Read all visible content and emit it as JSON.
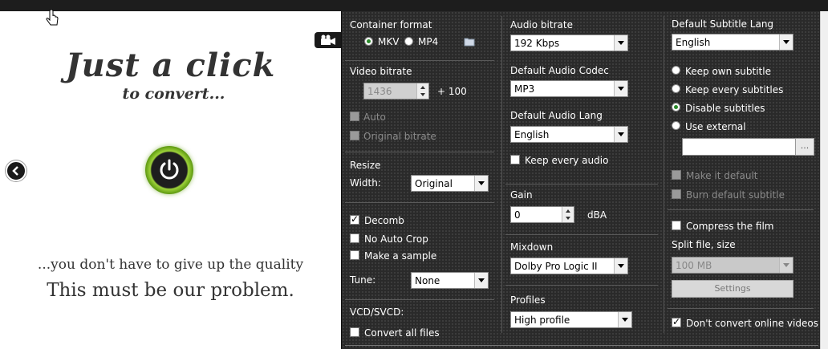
{
  "promo": {
    "headline": "Just a click",
    "subheadline": "to convert...",
    "tagline_1": "...you don't have to give up the quality",
    "tagline_2": "This must be our problem."
  },
  "col1": {
    "container_format_label": "Container format",
    "format_options": [
      "MKV",
      "MP4"
    ],
    "format_selected": "MKV",
    "video_bitrate_label": "Video bitrate",
    "video_bitrate_value": "1436",
    "video_bitrate_extra": "+ 100",
    "auto_label": "Auto",
    "original_bitrate_label": "Original bitrate",
    "resize_label": "Resize",
    "width_label": "Width:",
    "width_value": "Original",
    "decomb_label": "Decomb",
    "no_auto_crop_label": "No Auto Crop",
    "make_sample_label": "Make a sample",
    "tune_label": "Tune:",
    "tune_value": "None",
    "vcd_label": "VCD/SVCD:",
    "convert_all_label": "Convert all files"
  },
  "col2": {
    "audio_bitrate_label": "Audio bitrate",
    "audio_bitrate_value": "192 Kbps",
    "default_codec_label": "Default Audio Codec",
    "default_codec_value": "MP3",
    "default_lang_label": "Default Audio Lang",
    "default_lang_value": "English",
    "keep_every_audio_label": "Keep every audio",
    "gain_label": "Gain",
    "gain_value": "0",
    "gain_unit": "dBA",
    "mixdown_label": "Mixdown",
    "mixdown_value": "Dolby Pro Logic II",
    "profiles_label": "Profiles",
    "profiles_value": "High profile"
  },
  "col3": {
    "subtitle_lang_label": "Default Subtitle Lang",
    "subtitle_lang_value": "English",
    "keep_own_label": "Keep own subtitle",
    "keep_every_label": "Keep every subtitles",
    "disable_label": "Disable subtitles",
    "use_external_label": "Use external",
    "browse_label": "...",
    "make_default_label": "Make it default",
    "burn_default_label": "Burn default subtitle",
    "compress_label": "Compress the film",
    "split_label": "Split file, size",
    "split_value": "100 MB",
    "settings_label": "Settings",
    "dont_convert_label": "Don't convert online videos"
  },
  "icons": [
    "hand-cursor-icon",
    "power-icon",
    "chevron-left-icon",
    "camera-icon",
    "folder-icon"
  ],
  "colors": {
    "panel_bg": "#2a2a2a",
    "power_green": "#9ed33a"
  }
}
